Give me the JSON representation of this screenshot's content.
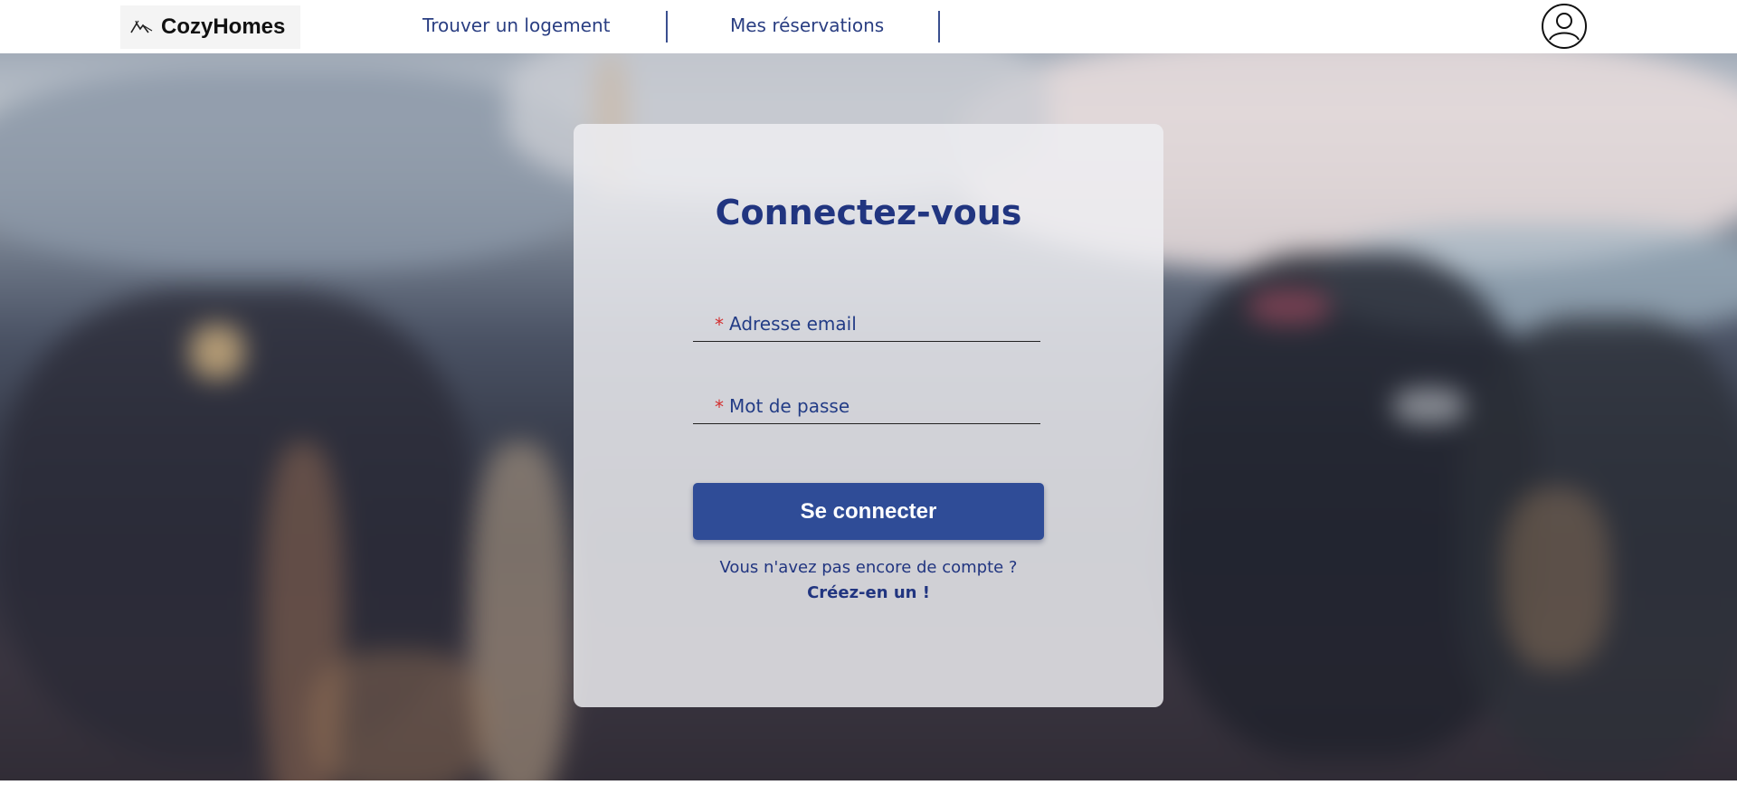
{
  "header": {
    "logo_text": "CozyHomes",
    "nav": [
      {
        "label": "Trouver un logement"
      },
      {
        "label": "Mes réservations"
      }
    ]
  },
  "login": {
    "title": "Connectez-vous",
    "required_marker": "*",
    "email_label": "Adresse email",
    "password_label": "Mot de passe",
    "submit_label": "Se connecter",
    "no_account_text": "Vous n'avez pas encore de compte ?",
    "signup_link": "Créez-en un !"
  },
  "colors": {
    "brand_blue": "#213580",
    "button_blue": "#2f4c97",
    "required_red": "#d32f2f"
  },
  "icons": [
    "mountain-logo-icon",
    "user-profile-icon"
  ]
}
